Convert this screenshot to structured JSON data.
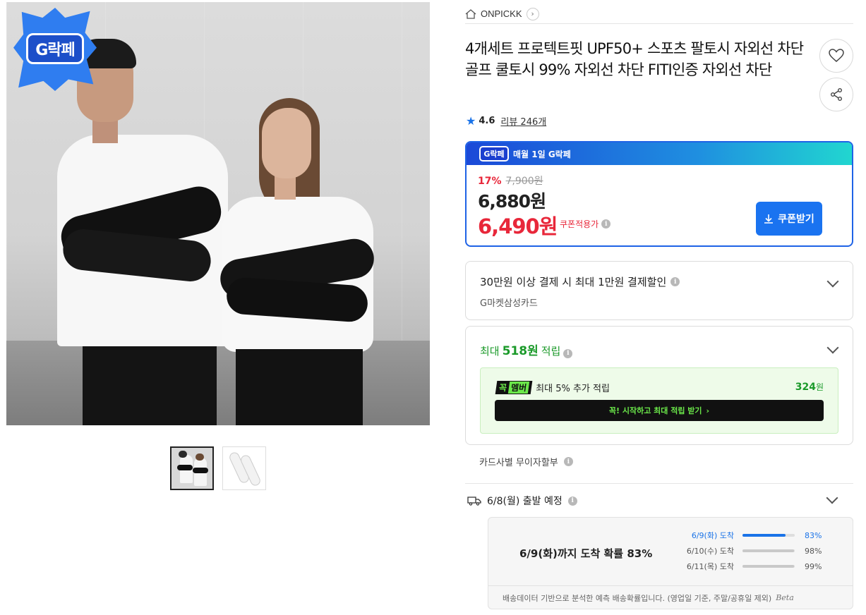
{
  "gallery": {
    "badge_label": "G락페",
    "thumbnails": [
      {
        "name": "thumb-models"
      },
      {
        "name": "thumb-sleeves"
      }
    ]
  },
  "header": {
    "brand": "ONPICKK",
    "brand_arrow": "›"
  },
  "product": {
    "title": "4개세트 프로텍트핏 UPF50+ 스포츠 팔토시 자외선 차단 골프 쿨토시 99% 자외선 차단 FITI인증 자외선 차단",
    "rating": "4.6",
    "review_label": "리뷰 246개"
  },
  "price": {
    "event_banner": "매월 1일 G락페",
    "event_badge": "G락페",
    "discount_rate": "17%",
    "original_price": "7,900원",
    "sale_price": "6,880원",
    "coupon_price": "6,490원",
    "coupon_note": "쿠폰적용가",
    "coupon_button": "쿠폰받기"
  },
  "card_benefit": {
    "title": "30만원 이상 결제 시 최대 1만원 결제할인",
    "subtitle": "G마켓삼성카드"
  },
  "points": {
    "prefix": "최대",
    "amount": "518원",
    "suffix": "적립",
    "member_tag_a": "꼭",
    "member_tag_b": "멤버",
    "member_text": "최대 5% 추가 적립",
    "member_points": "324",
    "member_points_unit": "원",
    "member_cta": "꼭! 시작하고 최대 적립 받기",
    "member_cta_arrow": "›"
  },
  "installment": {
    "label": "카드사별 무이자할부"
  },
  "shipping": {
    "departure": "6/8(월) 출발 예정",
    "summary": "6/9(화)까지 도착 확률 83%",
    "probabilities": [
      {
        "label": "6/9(화) 도착",
        "pct": "83%",
        "value": 0.83,
        "highlight": true
      },
      {
        "label": "6/10(수) 도착",
        "pct": "98%",
        "value": 0.98,
        "highlight": false
      },
      {
        "label": "6/11(목) 도착",
        "pct": "99%",
        "value": 0.99,
        "highlight": false
      }
    ],
    "note": "배송데이터 기반으로 분석한 예측 배송확률입니다. (영업일 기준, 주말/공휴일 제외)",
    "beta": "Beta"
  },
  "colors": {
    "accent_blue": "#1a73f0",
    "sale_red": "#e8273a",
    "points_green": "#1b9a2a"
  }
}
